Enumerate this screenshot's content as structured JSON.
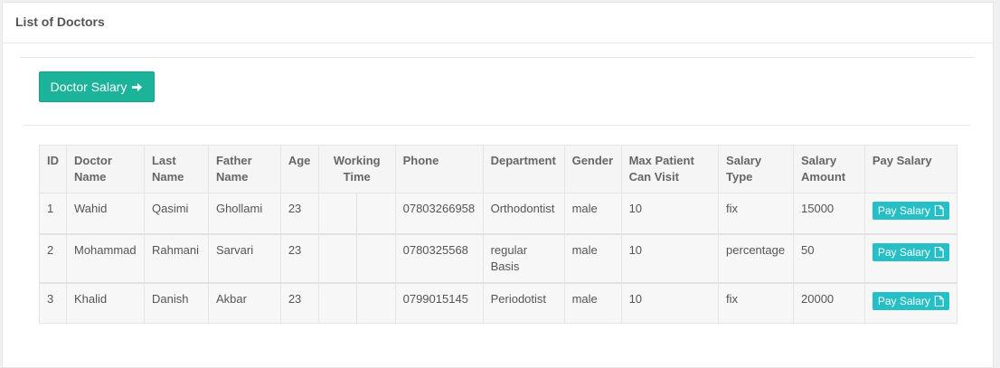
{
  "panel": {
    "title": "List of Doctors"
  },
  "toolbar": {
    "doctor_salary_label": "Doctor Salary"
  },
  "table": {
    "headers": {
      "id": "ID",
      "doctor_name": "Doctor Name",
      "last_name": "Last Name",
      "father_name": "Father Name",
      "age": "Age",
      "working_time": "Working Time",
      "phone": "Phone",
      "department": "Department",
      "gender": "Gender",
      "max_patient": "Max Patient Can Visit",
      "salary_type": "Salary Type",
      "salary_amount": "Salary Amount",
      "pay_salary": "Pay Salary"
    },
    "rows": [
      {
        "id": "1",
        "doctor_name": "Wahid",
        "last_name": "Qasimi",
        "father_name": "Ghollami",
        "age": "23",
        "phone": "07803266958",
        "department": "Orthodontist",
        "gender": "male",
        "max_patient": "10",
        "salary_type": "fix",
        "salary_amount": "15000",
        "pay_label": "Pay Salary"
      },
      {
        "id": "2",
        "doctor_name": "Mohammad",
        "last_name": "Rahmani",
        "father_name": "Sarvari",
        "age": "23",
        "phone": "0780325568",
        "department": "regular Basis",
        "gender": "male",
        "max_patient": "10",
        "salary_type": "percentage",
        "salary_amount": "50",
        "pay_label": "Pay Salary"
      },
      {
        "id": "3",
        "doctor_name": "Khalid",
        "last_name": "Danish",
        "father_name": "Akbar",
        "age": "23",
        "phone": "0799015145",
        "department": "Periodotist",
        "gender": "male",
        "max_patient": "10",
        "salary_type": "fix",
        "salary_amount": "20000",
        "pay_label": "Pay Salary"
      }
    ]
  },
  "icons": {
    "arrow": "arrow-right-icon",
    "file": "file-icon"
  },
  "colors": {
    "primary_button": "#1bb49a",
    "pay_button": "#26bfc6"
  }
}
